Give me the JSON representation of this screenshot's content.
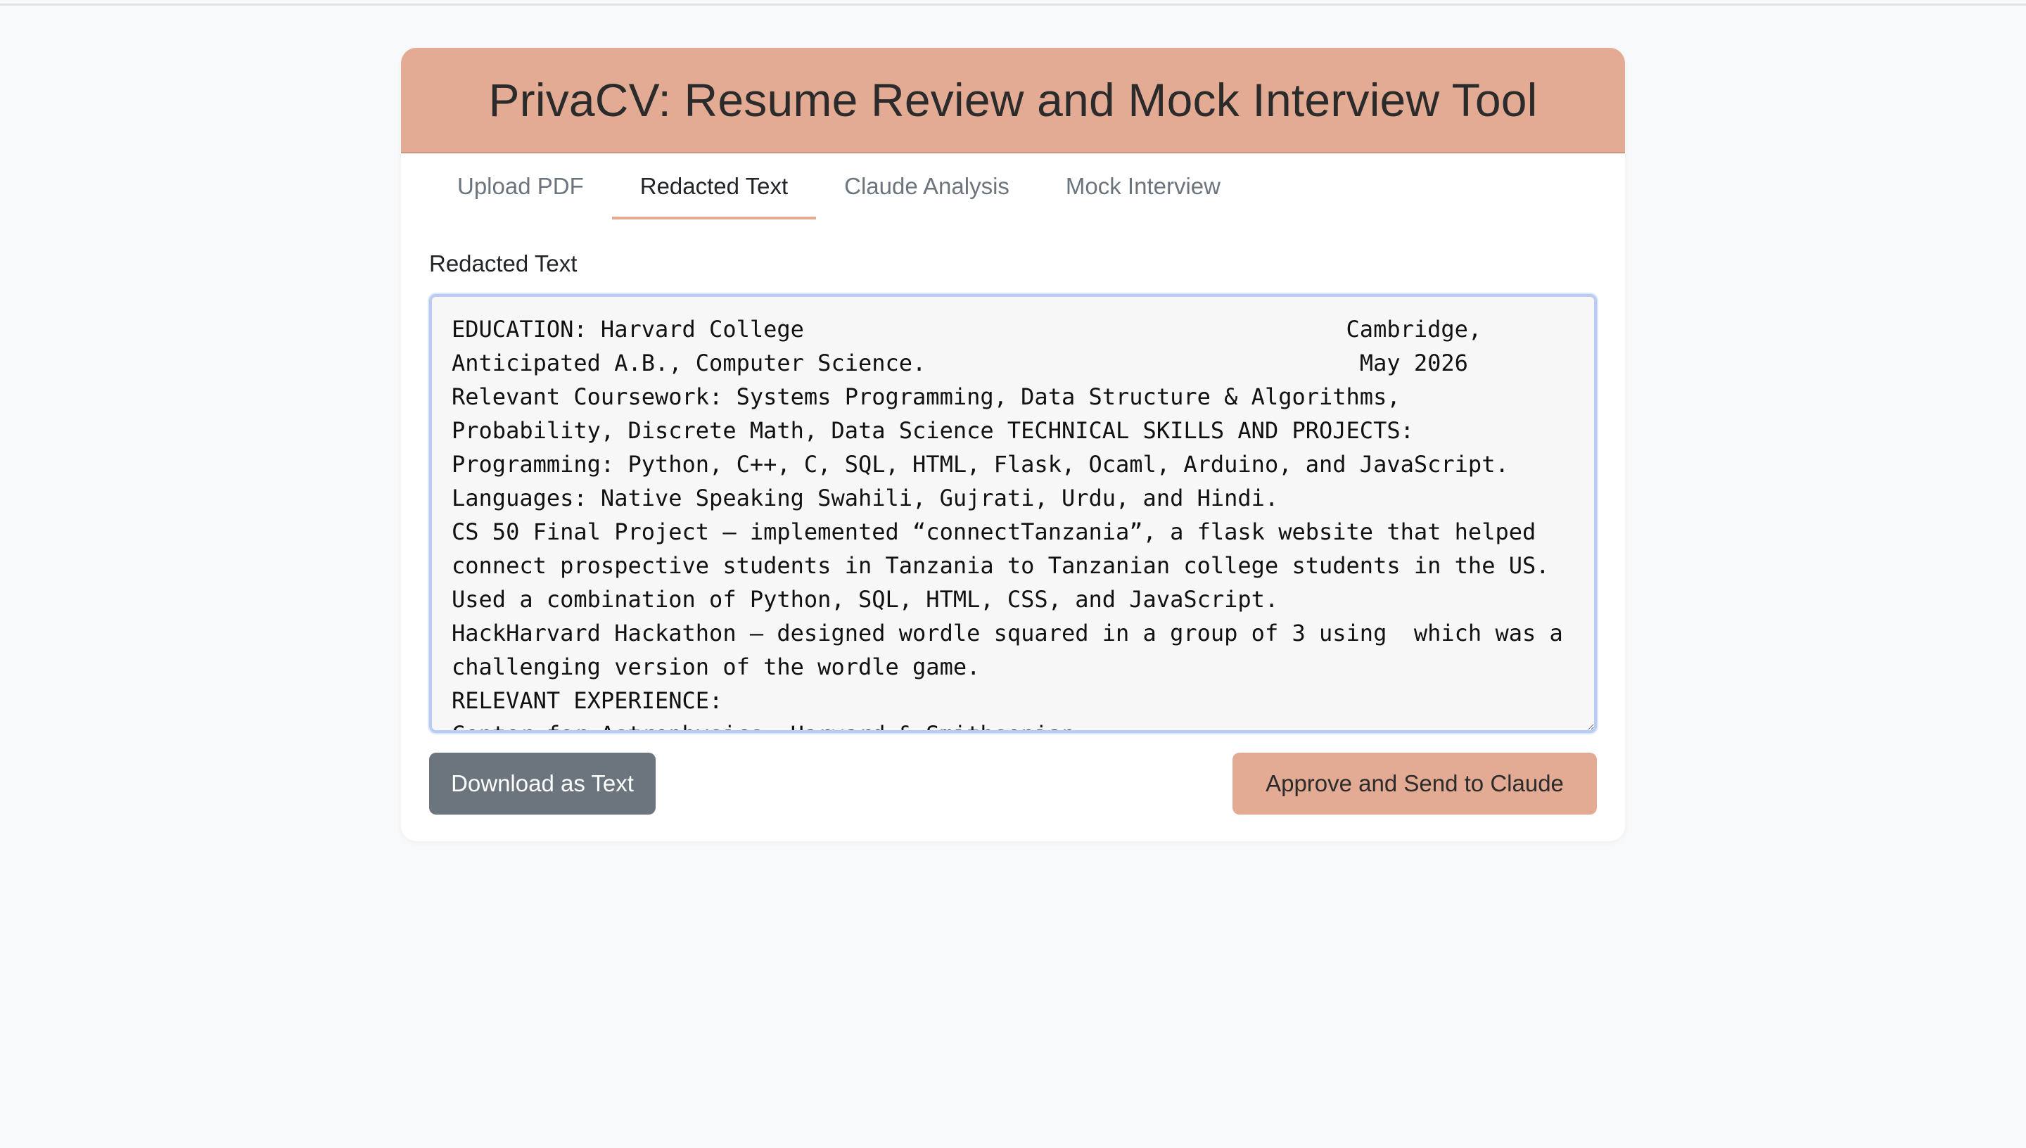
{
  "app": {
    "title": "PrivaCV: Resume Review and Mock Interview Tool"
  },
  "tabs": [
    {
      "label": "Upload PDF",
      "active": false
    },
    {
      "label": "Redacted Text",
      "active": true
    },
    {
      "label": "Claude Analysis",
      "active": false
    },
    {
      "label": "Mock Interview",
      "active": false
    }
  ],
  "redacted": {
    "label": "Redacted Text",
    "text": "EDUCATION: Harvard College                                        Cambridge,\nAnticipated A.B., Computer Science.                                May 2026\nRelevant Coursework: Systems Programming, Data Structure & Algorithms,\nProbability, Discrete Math, Data Science TECHNICAL SKILLS AND PROJECTS:\nProgramming: Python, C++, C, SQL, HTML, Flask, Ocaml, Arduino, and JavaScript.\nLanguages: Native Speaking Swahili, Gujrati, Urdu, and Hindi.\nCS 50 Final Project – implemented “connectTanzania”, a flask website that helped\nconnect prospective students in Tanzania to Tanzanian college students in the US.\nUsed a combination of Python, SQL, HTML, CSS, and JavaScript.\nHackHarvard Hackathon – designed wordle squared in a group of 3 using  which was a\nchallenging version of the wordle game.\nRELEVANT EXPERIENCE:\nCenter for Astrophysics, Harvard & Smithsonian"
  },
  "actions": {
    "download_label": "Download as Text",
    "approve_label": "Approve and Send to Claude"
  },
  "colors": {
    "accent": "#e3aa94",
    "secondary_button": "#6c757d",
    "background": "#f8f9fa"
  }
}
